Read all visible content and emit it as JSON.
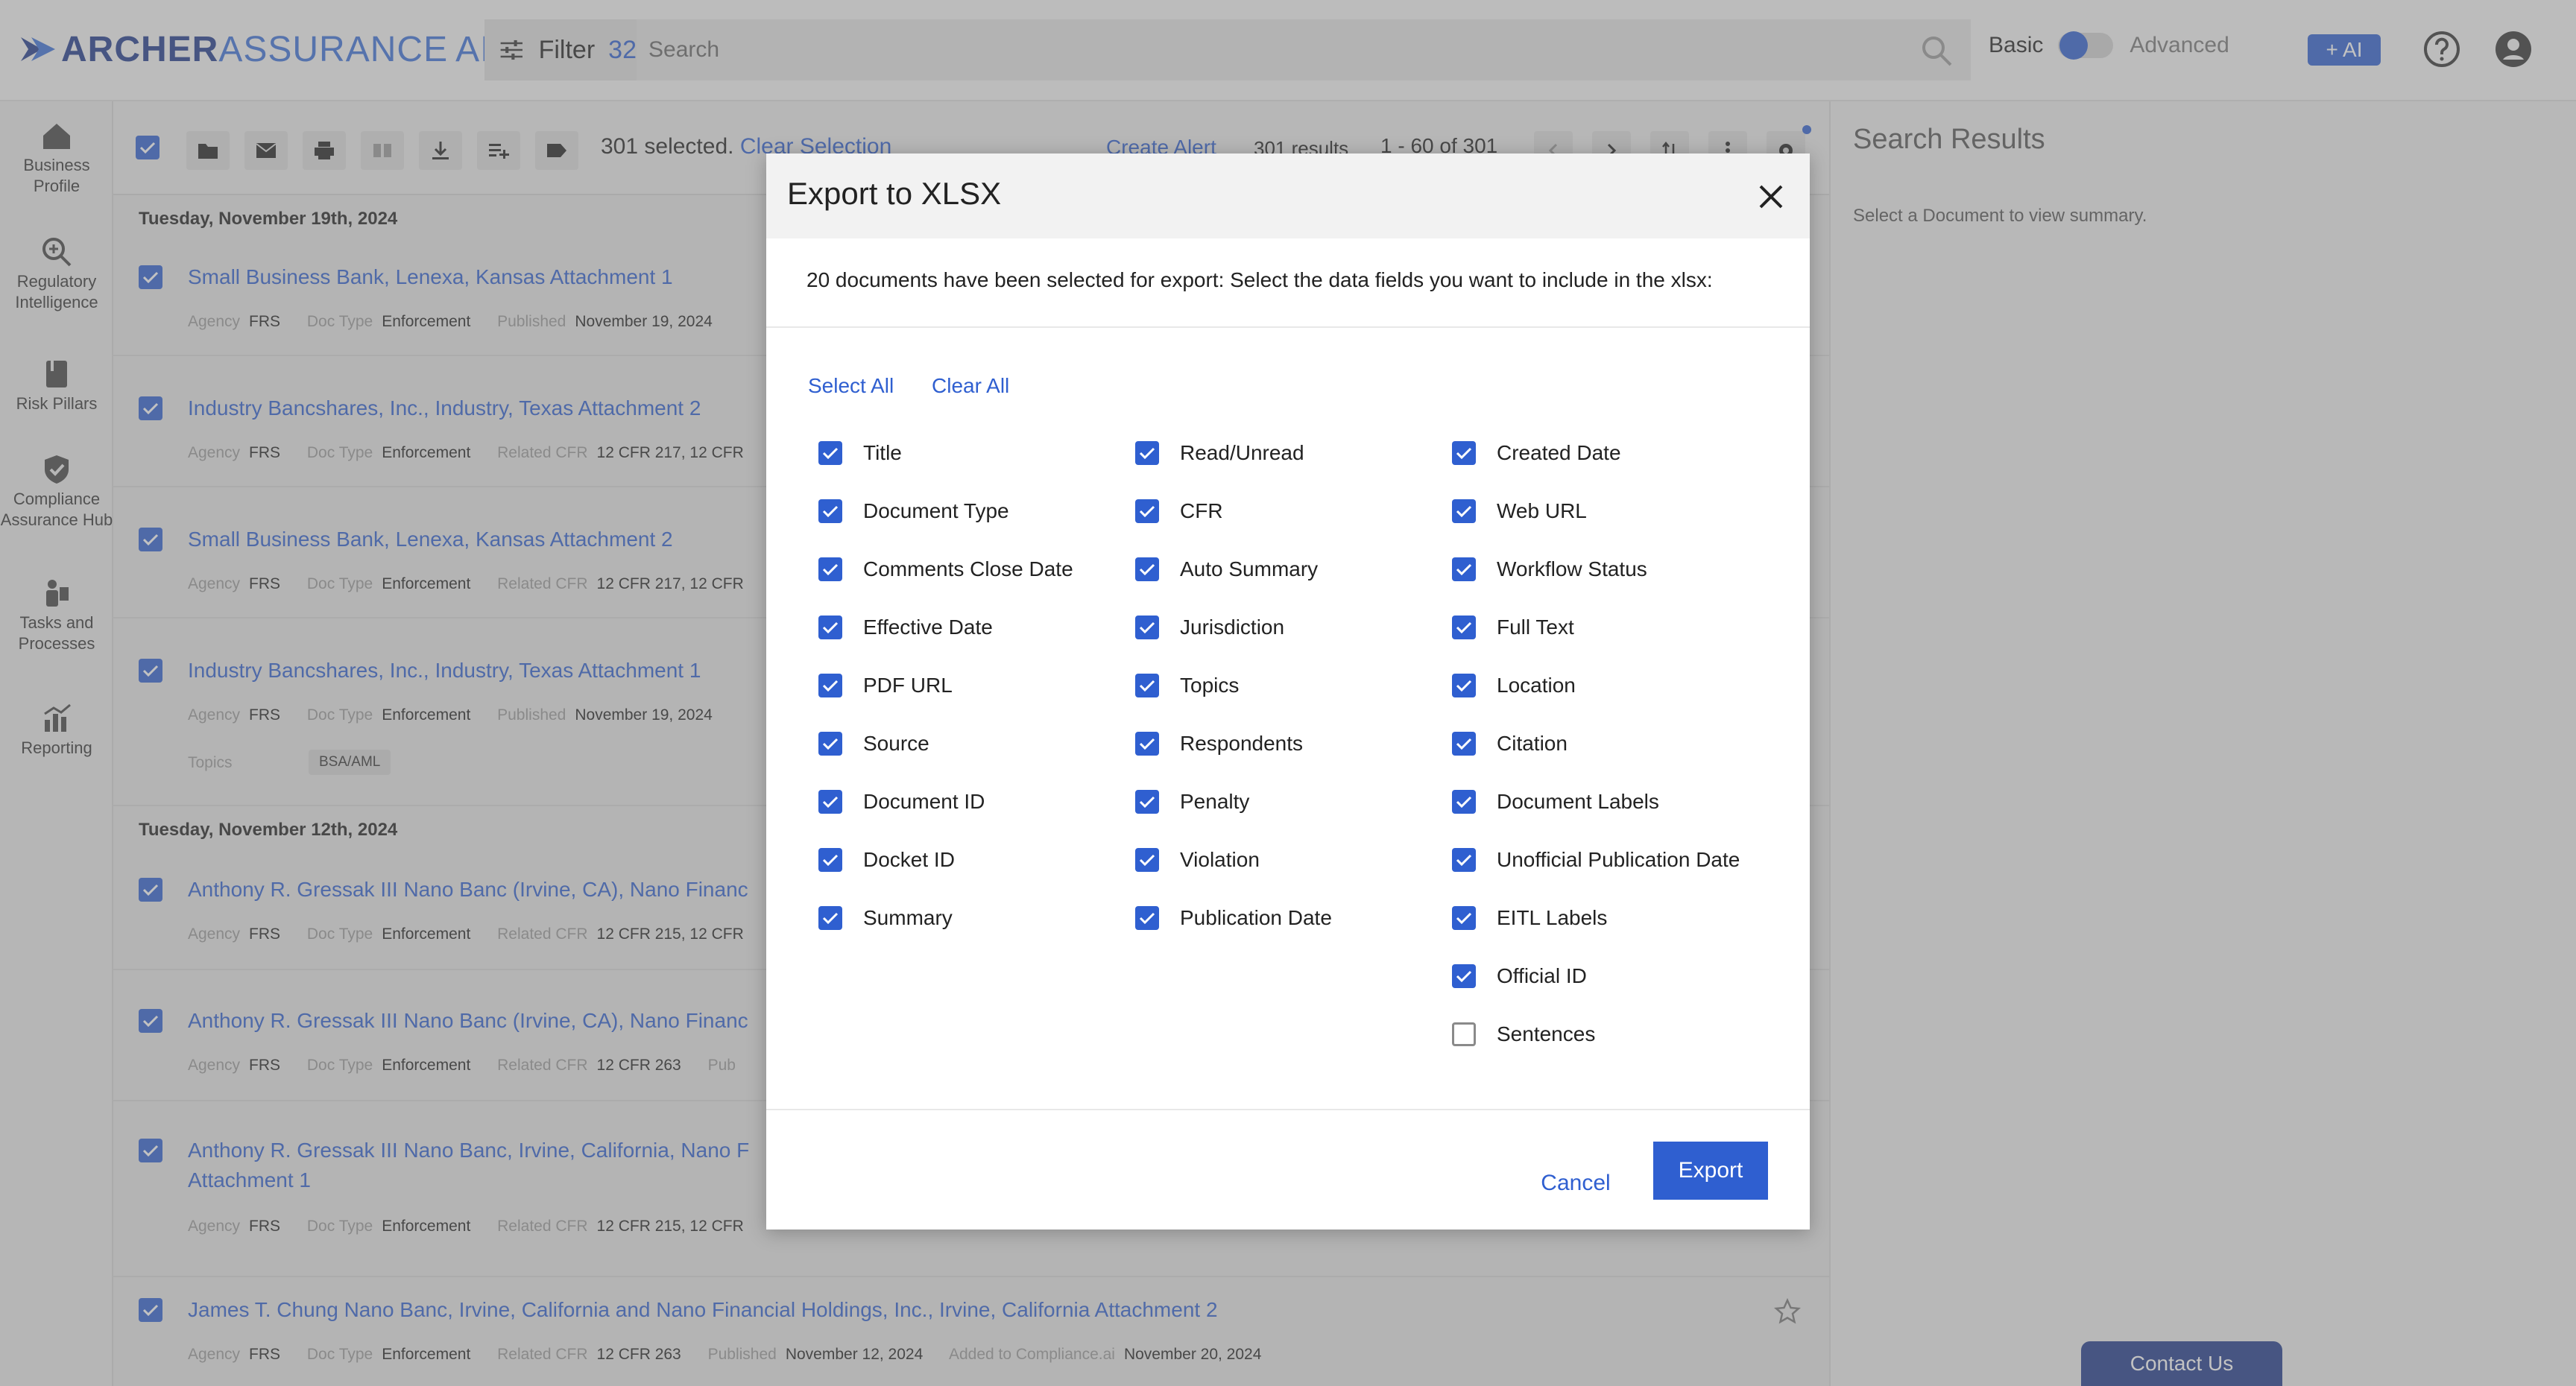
{
  "header": {
    "logo_part1": "ARCHER",
    "logo_part2": "ASSURANCE",
    "logo_part3": "AI",
    "filter_label": "Filter",
    "filter_count": "32",
    "search_placeholder": "Search",
    "mode_basic": "Basic",
    "mode_advanced": "Advanced",
    "ai_button": "+ AI"
  },
  "sidebar": {
    "items": [
      {
        "label": "Business Profile"
      },
      {
        "label": "Regulatory Intelligence"
      },
      {
        "label": "Risk Pillars"
      },
      {
        "label": "Compliance Assurance Hub"
      },
      {
        "label": "Tasks and Processes"
      },
      {
        "label": "Reporting"
      }
    ]
  },
  "toolbar": {
    "selected_text": "301 selected.",
    "clear_selection": "Clear Selection",
    "create_alert": "Create Alert",
    "results": "301 results",
    "pagination": "1 - 60 of 301"
  },
  "list": {
    "groups": [
      {
        "date": "Tuesday, November 19th, 2024"
      },
      {
        "date": "Tuesday, November 12th, 2024"
      }
    ],
    "meta_labels": {
      "agency": "Agency",
      "doc_type": "Doc Type",
      "related_cfr": "Related CFR",
      "published": "Published",
      "topics": "Topics",
      "added_to": "Added to Compliance.ai"
    },
    "rows": [
      {
        "title": "Small Business Bank, Lenexa, Kansas Attachment 1",
        "agency": "FRS",
        "doc_type": "Enforcement",
        "extra_key": "Published",
        "extra_val": "November 19, 2024"
      },
      {
        "title": "Industry Bancshares, Inc., Industry, Texas Attachment 2",
        "agency": "FRS",
        "doc_type": "Enforcement",
        "extra_key": "Related CFR",
        "extra_val": "12 CFR 217, 12 CFR"
      },
      {
        "title": "Small Business Bank, Lenexa, Kansas Attachment 2",
        "agency": "FRS",
        "doc_type": "Enforcement",
        "extra_key": "Related CFR",
        "extra_val": "12 CFR 217, 12 CFR"
      },
      {
        "title": "Industry Bancshares, Inc., Industry, Texas Attachment 1",
        "agency": "FRS",
        "doc_type": "Enforcement",
        "extra_key": "Published",
        "extra_val": "November 19, 2024",
        "topic": "BSA/AML"
      },
      {
        "title": "Anthony R. Gressak III Nano Banc (Irvine, CA), Nano Financ",
        "agency": "FRS",
        "doc_type": "Enforcement",
        "extra_key": "Related CFR",
        "extra_val": "12 CFR 215, 12 CFR"
      },
      {
        "title": "Anthony R. Gressak III Nano Banc (Irvine, CA), Nano Financ",
        "agency": "FRS",
        "doc_type": "Enforcement",
        "extra_key": "Related CFR",
        "extra_val": "12 CFR 263",
        "extra_key2": "Pub"
      },
      {
        "title": "Anthony R. Gressak III Nano Banc, Irvine, California, Nano F",
        "title2": "Attachment 1",
        "agency": "FRS",
        "doc_type": "Enforcement",
        "extra_key": "Related CFR",
        "extra_val": "12 CFR 215, 12 CFR"
      },
      {
        "title": "James T. Chung Nano Banc, Irvine, California and Nano Financial Holdings, Inc., Irvine, California Attachment 2",
        "agency": "FRS",
        "doc_type": "Enforcement",
        "extra_key": "Related CFR",
        "extra_val": "12 CFR 263",
        "published": "November 12, 2024",
        "added": "November 20, 2024"
      }
    ]
  },
  "right_panel": {
    "title": "Search Results",
    "subtitle": "Select a Document to view summary."
  },
  "contact_us": "Contact Us",
  "modal": {
    "title": "Export to XLSX",
    "description": "20 documents have been selected for export: Select the data fields you want to include in the xlsx:",
    "select_all": "Select All",
    "clear_all": "Clear All",
    "cancel": "Cancel",
    "export": "Export",
    "columns": [
      [
        {
          "label": "Title",
          "checked": true
        },
        {
          "label": "Document Type",
          "checked": true
        },
        {
          "label": "Comments Close Date",
          "checked": true
        },
        {
          "label": "Effective Date",
          "checked": true
        },
        {
          "label": "PDF URL",
          "checked": true
        },
        {
          "label": "Source",
          "checked": true
        },
        {
          "label": "Document ID",
          "checked": true
        },
        {
          "label": "Docket ID",
          "checked": true
        },
        {
          "label": "Summary",
          "checked": true
        }
      ],
      [
        {
          "label": "Read/Unread",
          "checked": true
        },
        {
          "label": "CFR",
          "checked": true
        },
        {
          "label": "Auto Summary",
          "checked": true
        },
        {
          "label": "Jurisdiction",
          "checked": true
        },
        {
          "label": "Topics",
          "checked": true
        },
        {
          "label": "Respondents",
          "checked": true
        },
        {
          "label": "Penalty",
          "checked": true
        },
        {
          "label": "Violation",
          "checked": true
        },
        {
          "label": "Publication Date",
          "checked": true
        }
      ],
      [
        {
          "label": "Created Date",
          "checked": true
        },
        {
          "label": "Web URL",
          "checked": true
        },
        {
          "label": "Workflow Status",
          "checked": true
        },
        {
          "label": "Full Text",
          "checked": true
        },
        {
          "label": "Location",
          "checked": true
        },
        {
          "label": "Citation",
          "checked": true
        },
        {
          "label": "Document Labels",
          "checked": true
        },
        {
          "label": "Unofficial Publication Date",
          "checked": true
        },
        {
          "label": "EITL Labels",
          "checked": true
        },
        {
          "label": "Official ID",
          "checked": true
        },
        {
          "label": "Sentences",
          "checked": false
        }
      ]
    ]
  },
  "colors": {
    "accent": "#2f5fd0",
    "brand_dark": "#1f3a8a"
  }
}
